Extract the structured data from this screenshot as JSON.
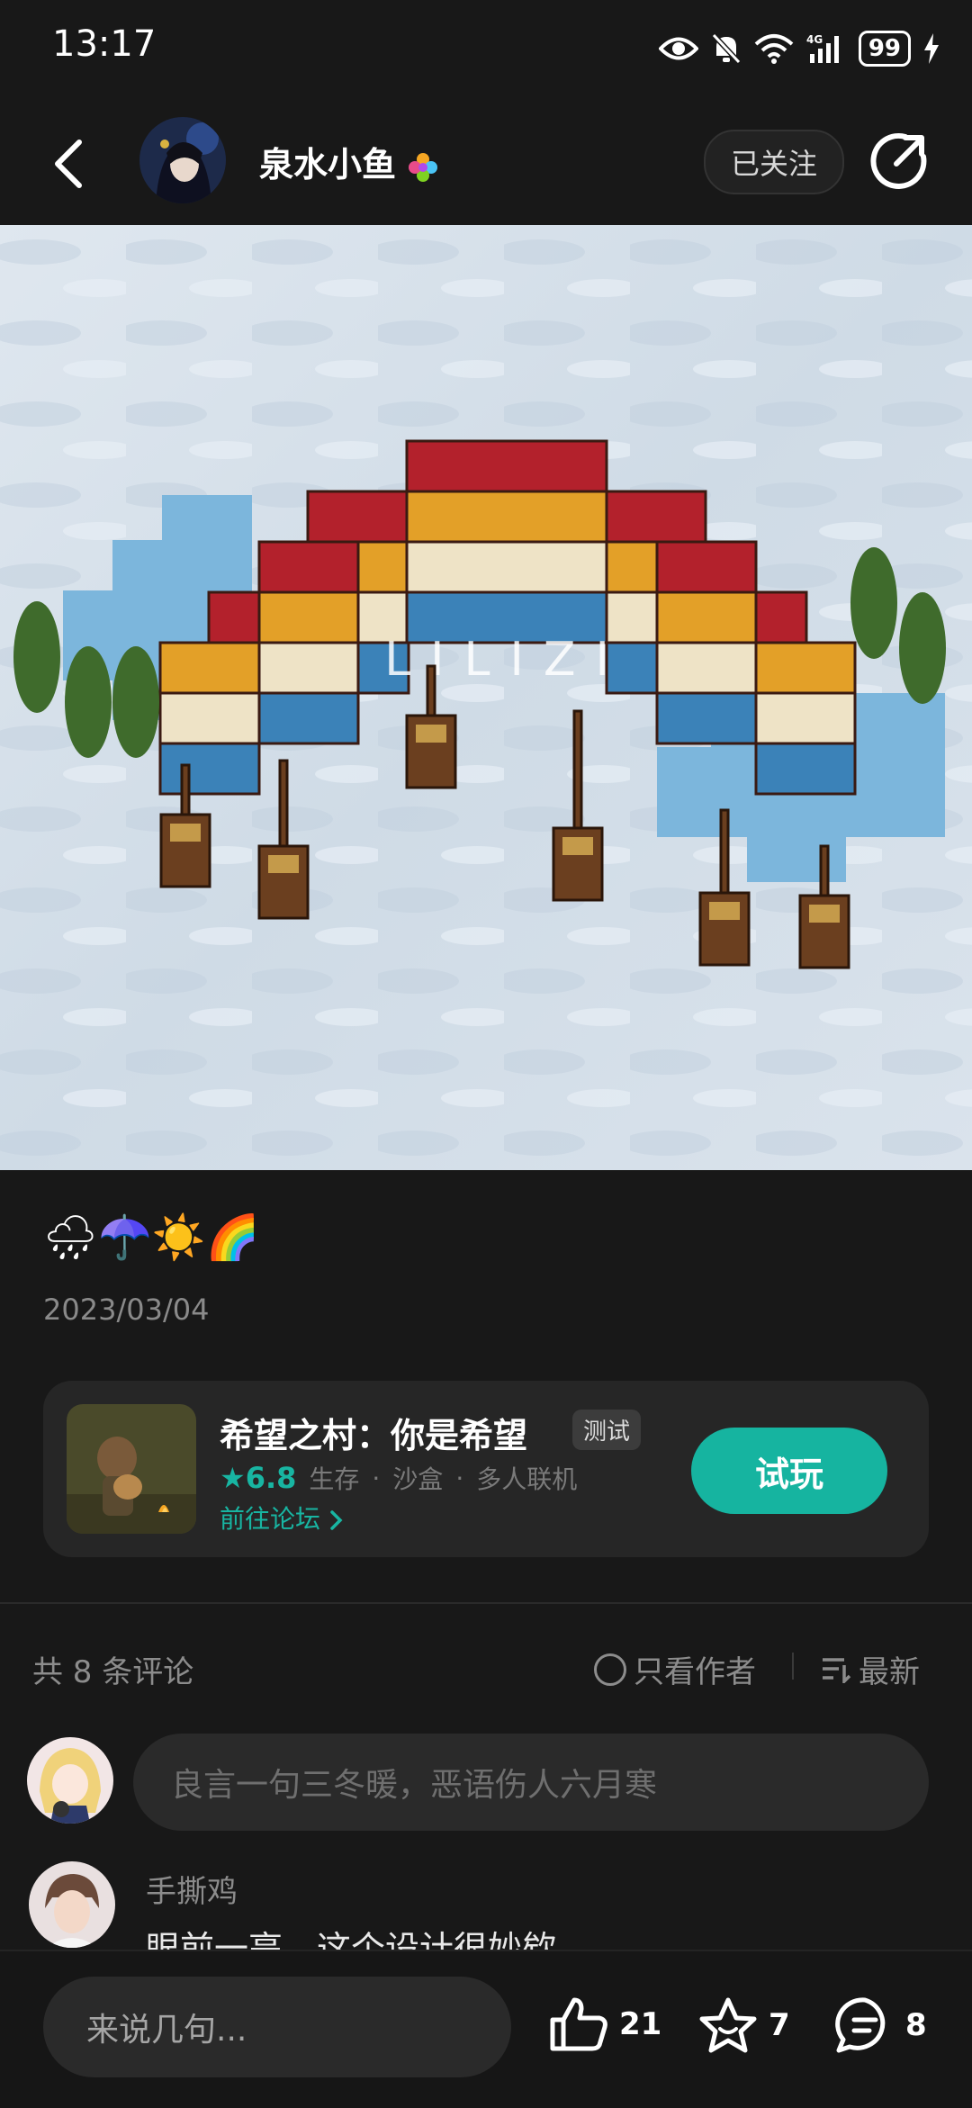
{
  "status_bar": {
    "time": "13:17",
    "battery": "99"
  },
  "header": {
    "username": "泉水小鱼",
    "follow_label": "已关注"
  },
  "post": {
    "image_watermark": "LILIZI",
    "caption": "🌧☂️☀️🌈",
    "date": "2023/03/04"
  },
  "game_card": {
    "title": "希望之村：你是希望",
    "badge": "测试",
    "rating": "6.8",
    "tags": [
      "生存",
      "沙盒",
      "多人联机"
    ],
    "forum_link": "前往论坛",
    "play_label": "试玩"
  },
  "comments": {
    "count_label": "共 8 条评论",
    "author_only_label": "只看作者",
    "sort_label": "最新",
    "input_placeholder": "良言一句三冬暖，恶语伤人六月寒",
    "items": [
      {
        "name": "手撕鸡",
        "text": "眼前一亮，这个设计很妙欸"
      }
    ]
  },
  "bottom_bar": {
    "input_placeholder": "来说几句...",
    "likes": "21",
    "favorites": "7",
    "comments": "8"
  },
  "colors": {
    "accent": "#16b4a0",
    "background": "#181818",
    "card": "#262626"
  }
}
